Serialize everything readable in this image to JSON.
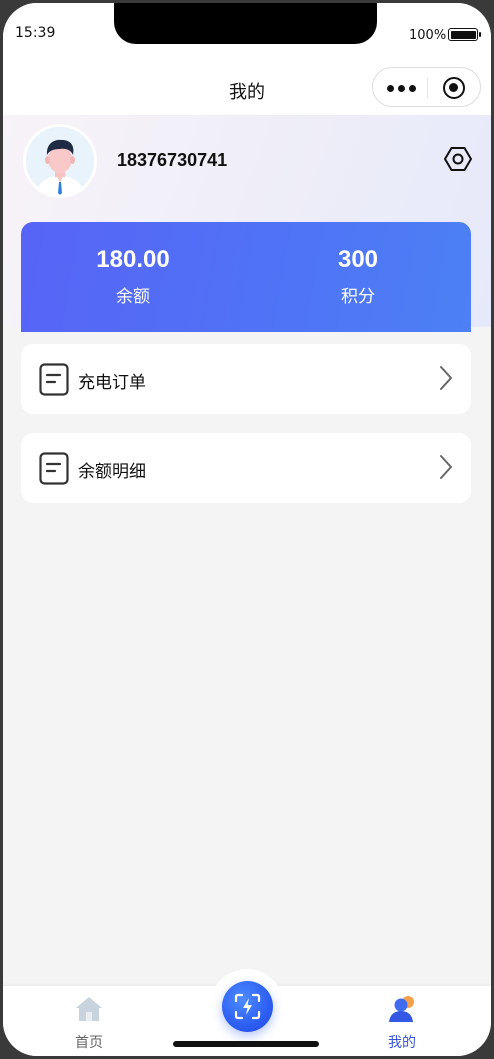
{
  "status_bar": {
    "time": "15:39",
    "battery": "100%"
  },
  "nav": {
    "title": "我的"
  },
  "profile": {
    "phone": "18376730741"
  },
  "balance_card": {
    "balance_value": "180.00",
    "balance_label": "余额",
    "points_value": "300",
    "points_label": "积分"
  },
  "menu": {
    "items": [
      {
        "label": "充电订单",
        "icon": "document-icon"
      },
      {
        "label": "余额明细",
        "icon": "document-icon"
      }
    ]
  },
  "tab_bar": {
    "tabs": [
      {
        "label": "首页",
        "icon": "home-icon"
      },
      {
        "label": "我的",
        "icon": "user-icon",
        "active": true
      }
    ],
    "center": {
      "icon": "scan-charge-icon"
    }
  },
  "colors": {
    "accent": "#4f6ff6",
    "tab_active": "#3a56d8",
    "background": "#f4f4f4"
  }
}
